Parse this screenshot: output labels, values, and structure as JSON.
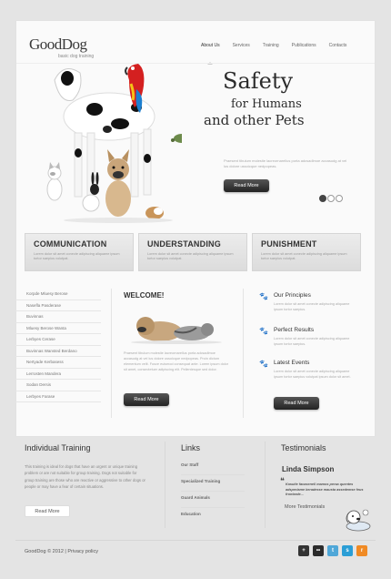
{
  "header": {
    "logo": "GoodDog",
    "tagline": "basic dog training",
    "nav": [
      "About Us",
      "Services",
      "Training",
      "Publications",
      "Contacts"
    ]
  },
  "hero": {
    "title_line1": "Safety",
    "title_line2": "for Humans",
    "title_line3": "and other Pets",
    "text": "Praesent tibulum molestie lacreornarellus porta adcsadlmoe accasudg at vel lus dolore ussoicque nedpopeas.",
    "button": "Read More",
    "slides": 3,
    "active_slide": 1
  },
  "features": [
    {
      "title": "COMMUNICATION",
      "text": "Lorem dolor sit amet conecte adipiscing aliquame ipsum tortor saepius volutpat."
    },
    {
      "title": "UNDERSTANDING",
      "text": "Lorem dolor sit amet conecte adipiscing aliquame ipsum tortor saepius volutpat."
    },
    {
      "title": "PUNISHMENT",
      "text": "Lorem dolor sit amet conecte adipiscing aliquame ipsum tortor saepius volutpat."
    }
  ],
  "sidebar_list": [
    "Korpde Mluesy Berose",
    "Nasefla Pasderase",
    "Buvinnas",
    "Mluesy Berose Wanta",
    "Lerbyes Cerase",
    "Buvinnas Wansted Berdano",
    "Nertyade Kerbasess",
    "Lerrosten Mandera",
    "Sodan Dersis",
    "Lerbyes Farase"
  ],
  "welcome": {
    "title": "WELCOME!",
    "text": "Praesent tibulum molestie lacreornarellus porta adcsadlmoe accasudg at vel lus dolore ussoicque nedpopeas. Proin dictum elementum velit. Fusce euismod consequat ante. Lorem ipsum dolor sit amet, consectetuer adipiscing elit. Pellentesque sed dolor.",
    "button": "Read More"
  },
  "right_column": [
    {
      "title": "Our Principles",
      "text": "Lorem dolor sit amet conecte adipiscing aliquame ipsum tortor saepius."
    },
    {
      "title": "Perfect Results",
      "text": "Lorem dolor sit amet conecte adipiscing aliquame ipsum tortor saepius."
    },
    {
      "title": "Latest Events",
      "text": "Lorem dolor sit amet conecte adipiscing aliquame ipsum tortor saepius volutpat ipsum dolor sit amet."
    }
  ],
  "right_button": "Read More",
  "footer": {
    "training_title": "Individual Training",
    "training_text": "This training is ideal for dogs that have an urgent or unique training problem or are not suitable for group training. Dogs not suitable for group training are those who are reactive or aggressive to other dogs or people or may have a fear of certain situations.",
    "training_button": "Read More",
    "links_title": "Links",
    "links": [
      "Our Staff",
      "Specialized Training",
      "Guard Animals",
      "Education"
    ],
    "testimonials_title": "Testimonials",
    "testimonial_name": "Linda Simpson",
    "testimonial_quote": "Kasuite facasenell mamos persa quentes adsperiame keradesse mausta assedemse feus frontarde...",
    "more_label": "More Testimonials",
    "copyright": "GoodDog © 2012  |  Privacy policy"
  },
  "socials": [
    {
      "icon": "plus-icon",
      "color": "#333333",
      "glyph": "+"
    },
    {
      "icon": "flickr-icon",
      "color": "#2b2b2b",
      "glyph": "••"
    },
    {
      "icon": "twitter-icon",
      "color": "#4fa7d8",
      "glyph": "t"
    },
    {
      "icon": "skype-icon",
      "color": "#2b9ed6",
      "glyph": "s"
    },
    {
      "icon": "rss-icon",
      "color": "#f08a24",
      "glyph": "r"
    }
  ]
}
